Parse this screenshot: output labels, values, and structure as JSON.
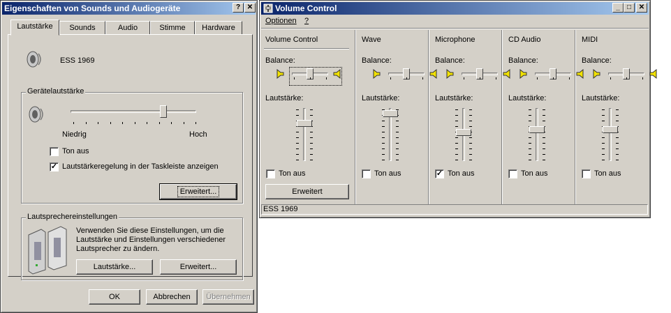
{
  "sounds": {
    "title": "Eigenschaften von Sounds und Audiogeräte",
    "tabs": [
      "Lautstärke",
      "Sounds",
      "Audio",
      "Stimme",
      "Hardware"
    ],
    "device_name": "ESS 1969",
    "device_volume_group": "Gerätelautstärke",
    "low_label": "Niedrig",
    "high_label": "Hoch",
    "volume_level": 0.75,
    "mute_label": "Ton aus",
    "mute_checked": false,
    "tray_label": "Lautstärkeregelung in der Taskleiste anzeigen",
    "tray_checked": true,
    "advanced_label": "Erweitert...",
    "speaker_group": "Lautsprechereinstellungen",
    "speaker_text": "Verwenden Sie diese Einstellungen, um die Lautstärke und Einstellungen verschiedener Lautsprecher zu ändern.",
    "speaker_volume_label": "Lautstärke...",
    "speaker_advanced_label": "Erweitert...",
    "ok_label": "OK",
    "cancel_label": "Abbrechen",
    "apply_label": "Übernehmen"
  },
  "volume_control": {
    "title": "Volume Control",
    "menu": [
      "Optionen",
      "?"
    ],
    "balance_label": "Balance:",
    "volume_label": "Lautstärke:",
    "mute_label": "Ton aus",
    "advanced_label": "Erweitert",
    "status": "ESS 1969",
    "channels": [
      {
        "name": "Volume Control",
        "balance": 0.5,
        "volume": 0.75,
        "muted": false
      },
      {
        "name": "Wave",
        "balance": 0.5,
        "volume": 0.95,
        "muted": false
      },
      {
        "name": "Microphone",
        "balance": 0.5,
        "volume": 0.55,
        "muted": true
      },
      {
        "name": "CD Audio",
        "balance": 0.5,
        "volume": 0.6,
        "muted": false
      },
      {
        "name": "MIDI",
        "balance": 0.5,
        "volume": 0.6,
        "muted": false
      }
    ]
  }
}
